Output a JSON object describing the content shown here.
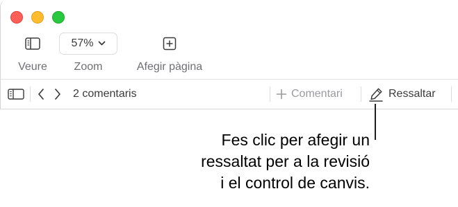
{
  "toolbar": {
    "view_label": "Veure",
    "zoom_value": "57%",
    "zoom_label": "Zoom",
    "add_page_label": "Afegir pàgina"
  },
  "comments_bar": {
    "count_label": "2 comentaris",
    "add_comment_label": "Comentari",
    "highlight_label": "Ressaltar"
  },
  "callout": {
    "lines": [
      "Fes clic per afegir un",
      "ressaltat per a la revisió",
      "i el control de canvis."
    ]
  }
}
